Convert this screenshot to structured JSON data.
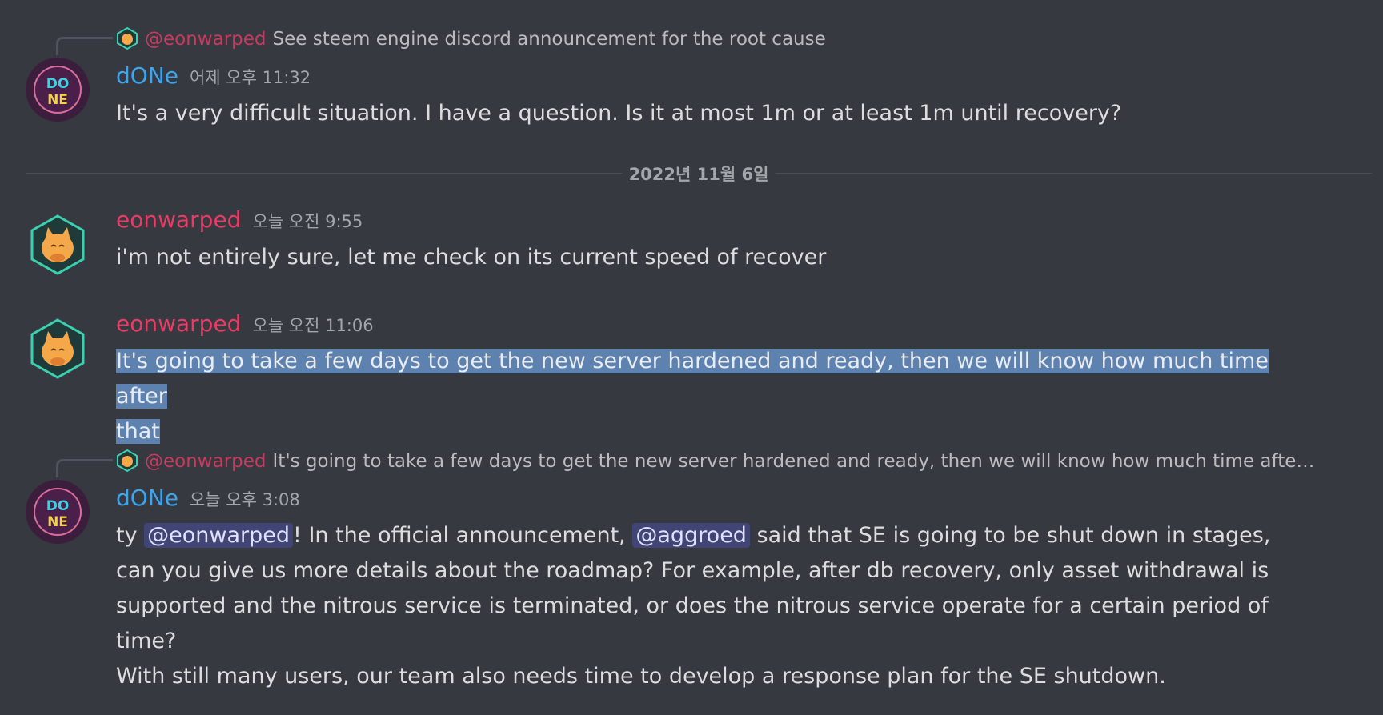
{
  "messages": [
    {
      "reply": {
        "name": "@eonwarped",
        "text": "See steem engine discord announcement for the root cause"
      },
      "author": "dONe",
      "time": "어제 오후 11:32",
      "text": "It's a very difficult situation. I have a question. Is it at most 1m or at least 1m until recovery?"
    },
    {
      "author": "eonwarped",
      "time": "오늘 오전 9:55",
      "text": "i'm not entirely sure, let me check on its current speed of recover"
    },
    {
      "author": "eonwarped",
      "time": "오늘 오전 11:06",
      "text_line1": "It's going to take a few days to get the new server hardened and ready, then we will know how much time after ",
      "text_line2": "that"
    },
    {
      "reply": {
        "name": "@eonwarped",
        "text": "It's going to take a few days to get the new server hardened and ready, then we will know how much time after ..."
      },
      "author": "dONe",
      "time": "오늘 오후 3:08",
      "text_prefix": "ty ",
      "mention1": "@eonwarped",
      "text_mid": "! In the official announcement, ",
      "mention2": "@aggroed",
      "text_rest": " said that SE is going to be shut down in stages, can you give us more details about the roadmap? For example, after db recovery, only asset withdrawal is supported and the nitrous service is terminated, or does the nitrous service operate for a certain period of time?",
      "text_para2": "With still many users, our team also needs time to develop a response plan for the SE shutdown."
    }
  ],
  "date_divider": "2022년 11월 6일",
  "colors": {
    "background": "#36393f",
    "done_name": "#3ba5f0",
    "eon_name": "#e83c66",
    "highlight": "#5e82b0",
    "mention_bg": "#4b4f8a"
  },
  "avatars": {
    "done": {
      "line1": "DO",
      "line2": "NE",
      "icon": "done-logo-avatar"
    },
    "eon": {
      "icon": "cat-hexagon-avatar"
    }
  }
}
